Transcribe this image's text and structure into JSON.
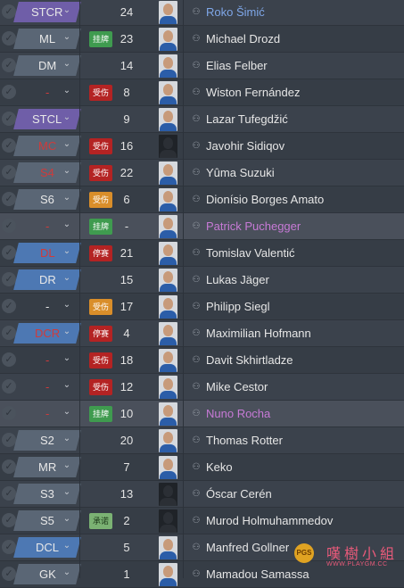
{
  "squad": {
    "players": [
      {
        "position": "STCR",
        "pos_style": "purple",
        "pos_text": "normal",
        "status": "",
        "status_type": "",
        "number": "24",
        "name": "Roko Šimić",
        "name_style": "link",
        "photo": "light"
      },
      {
        "position": "ML",
        "pos_style": "slate",
        "pos_text": "normal",
        "status": "挂牌",
        "status_type": "gua",
        "number": "23",
        "name": "Michael Drozd",
        "name_style": "",
        "photo": "light"
      },
      {
        "position": "DM",
        "pos_style": "slate",
        "pos_text": "normal",
        "status": "",
        "status_type": "",
        "number": "14",
        "name": "Elias Felber",
        "name_style": "",
        "photo": "light"
      },
      {
        "position": "-",
        "pos_style": "none",
        "pos_text": "red",
        "status": "受伤",
        "status_type": "inj",
        "number": "8",
        "name": "Wiston Fernández",
        "name_style": "",
        "photo": "light"
      },
      {
        "position": "STCL",
        "pos_style": "purple",
        "pos_text": "normal",
        "status": "",
        "status_type": "",
        "number": "9",
        "name": "Lazar Tufegdžić",
        "name_style": "",
        "photo": "light"
      },
      {
        "position": "MC",
        "pos_style": "slate",
        "pos_text": "red",
        "status": "受伤",
        "status_type": "inj",
        "number": "16",
        "name": "Javohir Sidiqov",
        "name_style": "",
        "photo": "dark"
      },
      {
        "position": "S4",
        "pos_style": "slate",
        "pos_text": "red",
        "status": "受伤",
        "status_type": "inj",
        "number": "22",
        "name": "Yûma Suzuki",
        "name_style": "",
        "photo": "light"
      },
      {
        "position": "S6",
        "pos_style": "slate",
        "pos_text": "normal",
        "status": "受伤",
        "status_type": "minor",
        "number": "6",
        "name": "Dionísio Borges Amato",
        "name_style": "",
        "photo": "light"
      },
      {
        "position": "-",
        "pos_style": "none",
        "pos_text": "red",
        "status": "挂牌",
        "status_type": "gua",
        "number": "-",
        "name": "Patrick Puchegger",
        "name_style": "pink",
        "photo": "light",
        "highlight": true
      },
      {
        "position": "DL",
        "pos_style": "blue",
        "pos_text": "red",
        "status": "停赛",
        "status_type": "ban",
        "number": "21",
        "name": "Tomislav Valentić",
        "name_style": "",
        "photo": "light"
      },
      {
        "position": "DR",
        "pos_style": "blue",
        "pos_text": "normal",
        "status": "",
        "status_type": "",
        "number": "15",
        "name": "Lukas Jäger",
        "name_style": "",
        "photo": "light"
      },
      {
        "position": "-",
        "pos_style": "none",
        "pos_text": "normal",
        "status": "受伤",
        "status_type": "minor",
        "number": "17",
        "name": "Philipp Siegl",
        "name_style": "",
        "photo": "light"
      },
      {
        "position": "DCR",
        "pos_style": "blue",
        "pos_text": "red",
        "status": "停赛",
        "status_type": "ban",
        "number": "4",
        "name": "Maximilian Hofmann",
        "name_style": "",
        "photo": "light"
      },
      {
        "position": "-",
        "pos_style": "none",
        "pos_text": "red",
        "status": "受伤",
        "status_type": "inj",
        "number": "18",
        "name": "Davit Skhirtladze",
        "name_style": "",
        "photo": "light"
      },
      {
        "position": "-",
        "pos_style": "none",
        "pos_text": "red",
        "status": "受伤",
        "status_type": "inj",
        "number": "12",
        "name": "Mike Cestor",
        "name_style": "",
        "photo": "light"
      },
      {
        "position": "-",
        "pos_style": "none",
        "pos_text": "red",
        "status": "挂牌",
        "status_type": "gua",
        "number": "10",
        "name": "Nuno Rocha",
        "name_style": "pink",
        "photo": "light",
        "highlight": true
      },
      {
        "position": "S2",
        "pos_style": "slate",
        "pos_text": "normal",
        "status": "",
        "status_type": "",
        "number": "20",
        "name": "Thomas Rotter",
        "name_style": "",
        "photo": "light"
      },
      {
        "position": "MR",
        "pos_style": "slate",
        "pos_text": "normal",
        "status": "",
        "status_type": "",
        "number": "7",
        "name": "Keko",
        "name_style": "",
        "photo": "light"
      },
      {
        "position": "S3",
        "pos_style": "slate",
        "pos_text": "normal",
        "status": "",
        "status_type": "",
        "number": "13",
        "name": "Óscar Cerén",
        "name_style": "",
        "photo": "dark"
      },
      {
        "position": "S5",
        "pos_style": "slate",
        "pos_text": "normal",
        "status": "承诺",
        "status_type": "prom",
        "number": "2",
        "name": "Murod Holmuhammedov",
        "name_style": "",
        "photo": "dark"
      },
      {
        "position": "DCL",
        "pos_style": "blue",
        "pos_text": "normal",
        "status": "",
        "status_type": "",
        "number": "5",
        "name": "Manfred Gollner",
        "name_style": "",
        "photo": "light"
      },
      {
        "position": "GK",
        "pos_style": "slate",
        "pos_text": "normal",
        "status": "",
        "status_type": "",
        "number": "1",
        "name": "Mamadou Samassa",
        "name_style": "",
        "photo": "light"
      }
    ]
  },
  "icons": {
    "check": "✓",
    "chevron": "⌄",
    "person": "⚇"
  },
  "watermark": {
    "logo_text": "PGS",
    "title": "嘆樹小組",
    "url": "WWW.PLAYGM.CC"
  },
  "colors": {
    "accent_link": "#7fa7e8",
    "accent_pink": "#c77ad6",
    "injury_red": "#b42323",
    "listed_green": "#3f9b4f",
    "minor_orange": "#d98e2a"
  }
}
